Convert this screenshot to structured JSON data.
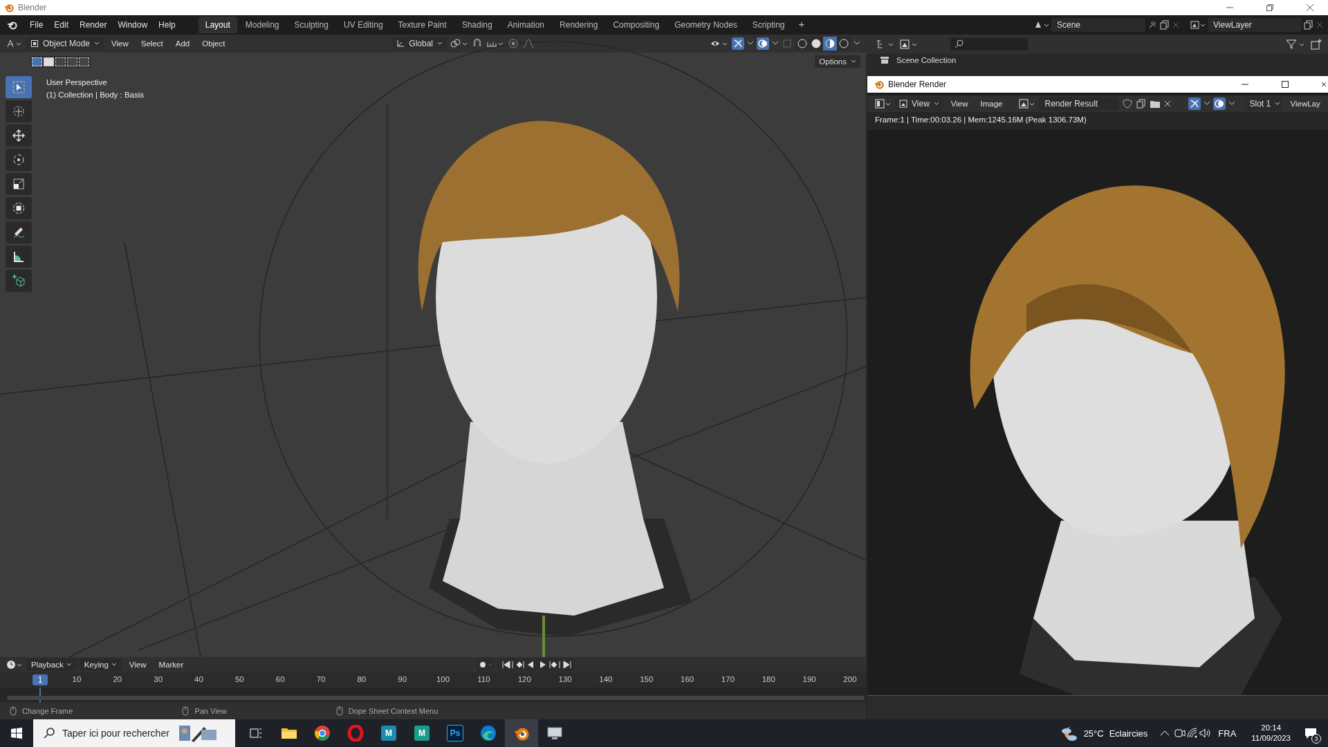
{
  "window": {
    "title": "Blender"
  },
  "menu": [
    "File",
    "Edit",
    "Render",
    "Window",
    "Help"
  ],
  "workspaces": [
    {
      "label": "Layout",
      "selected": true
    },
    {
      "label": "Modeling",
      "selected": false
    },
    {
      "label": "Sculpting",
      "selected": false
    },
    {
      "label": "UV Editing",
      "selected": false
    },
    {
      "label": "Texture Paint",
      "selected": false
    },
    {
      "label": "Shading",
      "selected": false
    },
    {
      "label": "Animation",
      "selected": false
    },
    {
      "label": "Rendering",
      "selected": false
    },
    {
      "label": "Compositing",
      "selected": false
    },
    {
      "label": "Geometry Nodes",
      "selected": false
    },
    {
      "label": "Scripting",
      "selected": false
    }
  ],
  "add_workspace": "+",
  "scene": "Scene",
  "view_layer": "ViewLayer",
  "viewport": {
    "mode": "Object Mode",
    "menus": [
      "View",
      "Select",
      "Add",
      "Object"
    ],
    "orientation": "Global",
    "options": "Options",
    "overlay": [
      "User Perspective",
      "(1) Collection | Body : Basis"
    ],
    "shading": [
      {
        "selected": false
      },
      {
        "selected": false
      },
      {
        "selected": true
      },
      {
        "selected": false
      }
    ],
    "tools": [
      {
        "kind": "select",
        "selected": true
      },
      {
        "kind": "cursor",
        "selected": false
      },
      {
        "kind": "move",
        "selected": false
      },
      {
        "kind": "rotate",
        "selected": false
      },
      {
        "kind": "scale",
        "selected": false
      },
      {
        "kind": "transform",
        "selected": false
      },
      {
        "kind": "annotate",
        "selected": false
      },
      {
        "kind": "measure",
        "selected": false
      },
      {
        "kind": "add-cube",
        "selected": false
      }
    ]
  },
  "outliner": {
    "items": [
      "Scene Collection"
    ]
  },
  "render_window": {
    "title": "Blender Render",
    "view_dropdown": "View",
    "menus": [
      "View",
      "Image"
    ],
    "image": "Render Result",
    "slot": "Slot 1",
    "view_layer": "ViewLay",
    "info": "Frame:1 | Time:00:03.26 | Mem:1245.16M (Peak 1306.73M)"
  },
  "timeline": {
    "menus": [
      "Playback",
      "Keying",
      "View",
      "Marker"
    ],
    "current_frame": "1",
    "ticks": [
      "10",
      "20",
      "30",
      "40",
      "50",
      "60",
      "70",
      "80",
      "90",
      "100",
      "110",
      "120",
      "130",
      "140",
      "150",
      "160",
      "170",
      "180",
      "190",
      "200"
    ]
  },
  "status_bar": [
    "Change Frame",
    "Pan View",
    "Dope Sheet Context Menu"
  ],
  "taskbar": {
    "search_placeholder": "Taper ici pour rechercher",
    "apps": [
      {
        "kind": "task-view",
        "selected": false
      },
      {
        "kind": "folder",
        "selected": false
      },
      {
        "kind": "chrome",
        "selected": false
      },
      {
        "kind": "opera",
        "selected": false
      },
      {
        "kind": "maya",
        "label": "M",
        "selected": false
      },
      {
        "kind": "maya2",
        "label": "M",
        "selected": false
      },
      {
        "kind": "photoshop",
        "label": "Ps",
        "selected": false
      },
      {
        "kind": "edge",
        "selected": false
      },
      {
        "kind": "blender",
        "selected": true
      },
      {
        "kind": "monitor",
        "selected": false
      }
    ],
    "temperature": "25°C",
    "weather": "Eclaircies",
    "language": "FRA",
    "time": "20:14",
    "date": "11/09/2023",
    "notifications": "3"
  }
}
